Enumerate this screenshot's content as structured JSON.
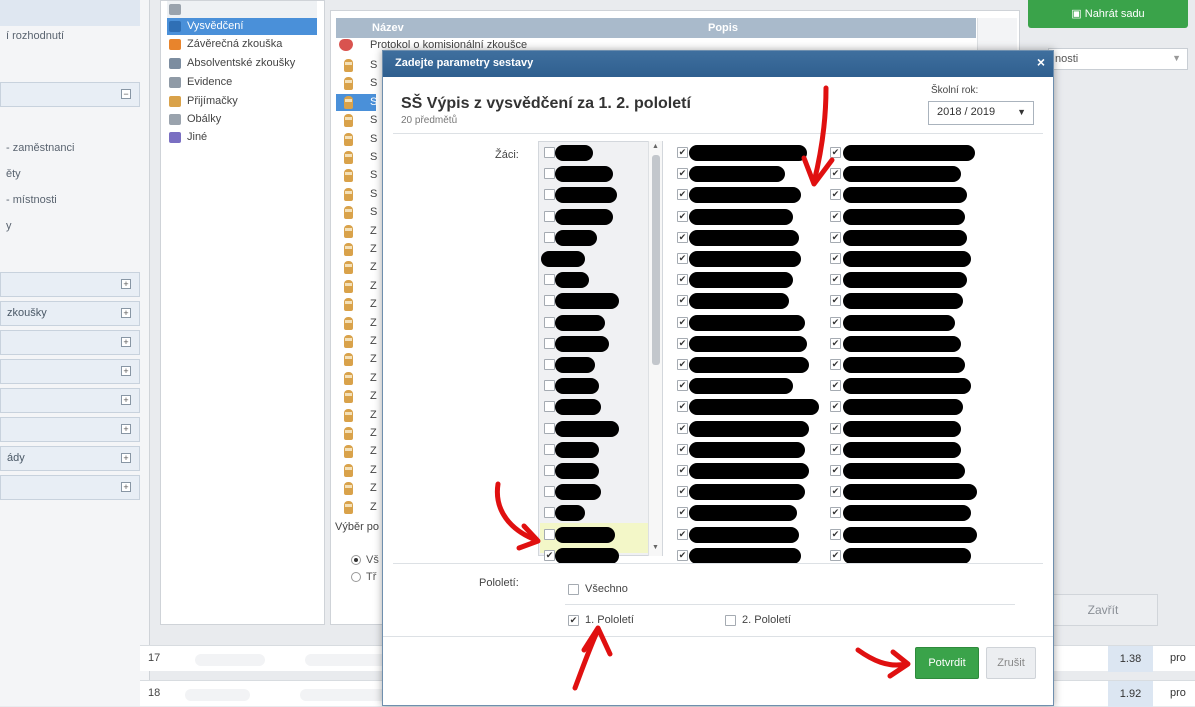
{
  "sidebar": {
    "links": [
      "í rozhodnutí",
      "- zaměstnanci",
      "ěty",
      "- místnosti",
      "y"
    ],
    "accordions": [
      "",
      "",
      "zkoušky",
      "",
      "",
      "",
      "",
      "ády",
      ""
    ]
  },
  "categories": [
    {
      "label": "Vysvědčení",
      "selected": true,
      "color": "#2f6fb5"
    },
    {
      "label": "Závěrečná zkouška",
      "selected": false,
      "color": "#e8842c"
    },
    {
      "label": "Absolventské zkoušky",
      "selected": false,
      "color": "#7c8da0"
    },
    {
      "label": "Evidence",
      "selected": false,
      "color": "#8f9aa6"
    },
    {
      "label": "Přijímačky",
      "selected": false,
      "color": "#d9a24a"
    },
    {
      "label": "Obálky",
      "selected": false,
      "color": "#9aa3ad"
    },
    {
      "label": "Jiné",
      "selected": false,
      "color": "#7a6fc2"
    }
  ],
  "reports": {
    "header_col1": "Název",
    "header_col2": "Popis",
    "first_row": "Protokol o komisionální zkoušce",
    "row_letters": [
      "S",
      "S",
      "S",
      "S",
      "S",
      "S",
      "S",
      "S",
      "S",
      "Z",
      "Z",
      "Z",
      "Z",
      "Z",
      "Z",
      "Z",
      "Z",
      "Z",
      "Z",
      "Z",
      "Z",
      "Z",
      "Z",
      "Z",
      "Z"
    ],
    "selection_label": "Výběr po",
    "radio_1": "Vš",
    "radio_2": "Tř"
  },
  "right": {
    "top_button": "Nahrát sadu",
    "select_value": "nosti",
    "close_button": "Zavřít"
  },
  "bottom_rows": [
    {
      "num": "17",
      "score": "1.38",
      "tail": "pro"
    },
    {
      "num": "18",
      "score": "1.92",
      "tail": "pro"
    }
  ],
  "modal": {
    "header": "Zadejte parametry sestavy",
    "close_glyph": "×",
    "title": "SŠ Výpis z vysvědčení za 1. 2. pololetí",
    "subtitle": "20 předmětů",
    "year_label": "Školní rok:",
    "year_value": "2018 / 2019",
    "students_label": "Žáci:",
    "semester_label": "Pololetí:",
    "opt_all": "Všechno",
    "opt_sem1": "1. Pololetí",
    "opt_sem2": "2. Pololetí",
    "confirm": "Potvrdit",
    "cancel": "Zrušit",
    "students": [
      {
        "checked": false
      },
      {
        "checked": false
      },
      {
        "checked": false
      },
      {
        "checked": false
      },
      {
        "checked": false
      },
      {
        "checked": false
      },
      {
        "checked": false
      },
      {
        "checked": false
      },
      {
        "checked": false
      },
      {
        "checked": false
      },
      {
        "checked": false
      },
      {
        "checked": false
      },
      {
        "checked": false
      },
      {
        "checked": false
      },
      {
        "checked": false
      },
      {
        "checked": false
      },
      {
        "checked": false
      },
      {
        "checked": false
      },
      {
        "checked": false
      },
      {
        "checked": true
      }
    ],
    "subjects_col1": 20,
    "subjects_col2": 20,
    "sem_all_checked": false,
    "sem1_checked": true,
    "sem2_checked": false
  },
  "colors": {
    "accent_green": "#3aa34a",
    "modal_header": "#3f6f9e",
    "selection_blue": "#4a90d9",
    "annotation_red": "#e01010"
  }
}
